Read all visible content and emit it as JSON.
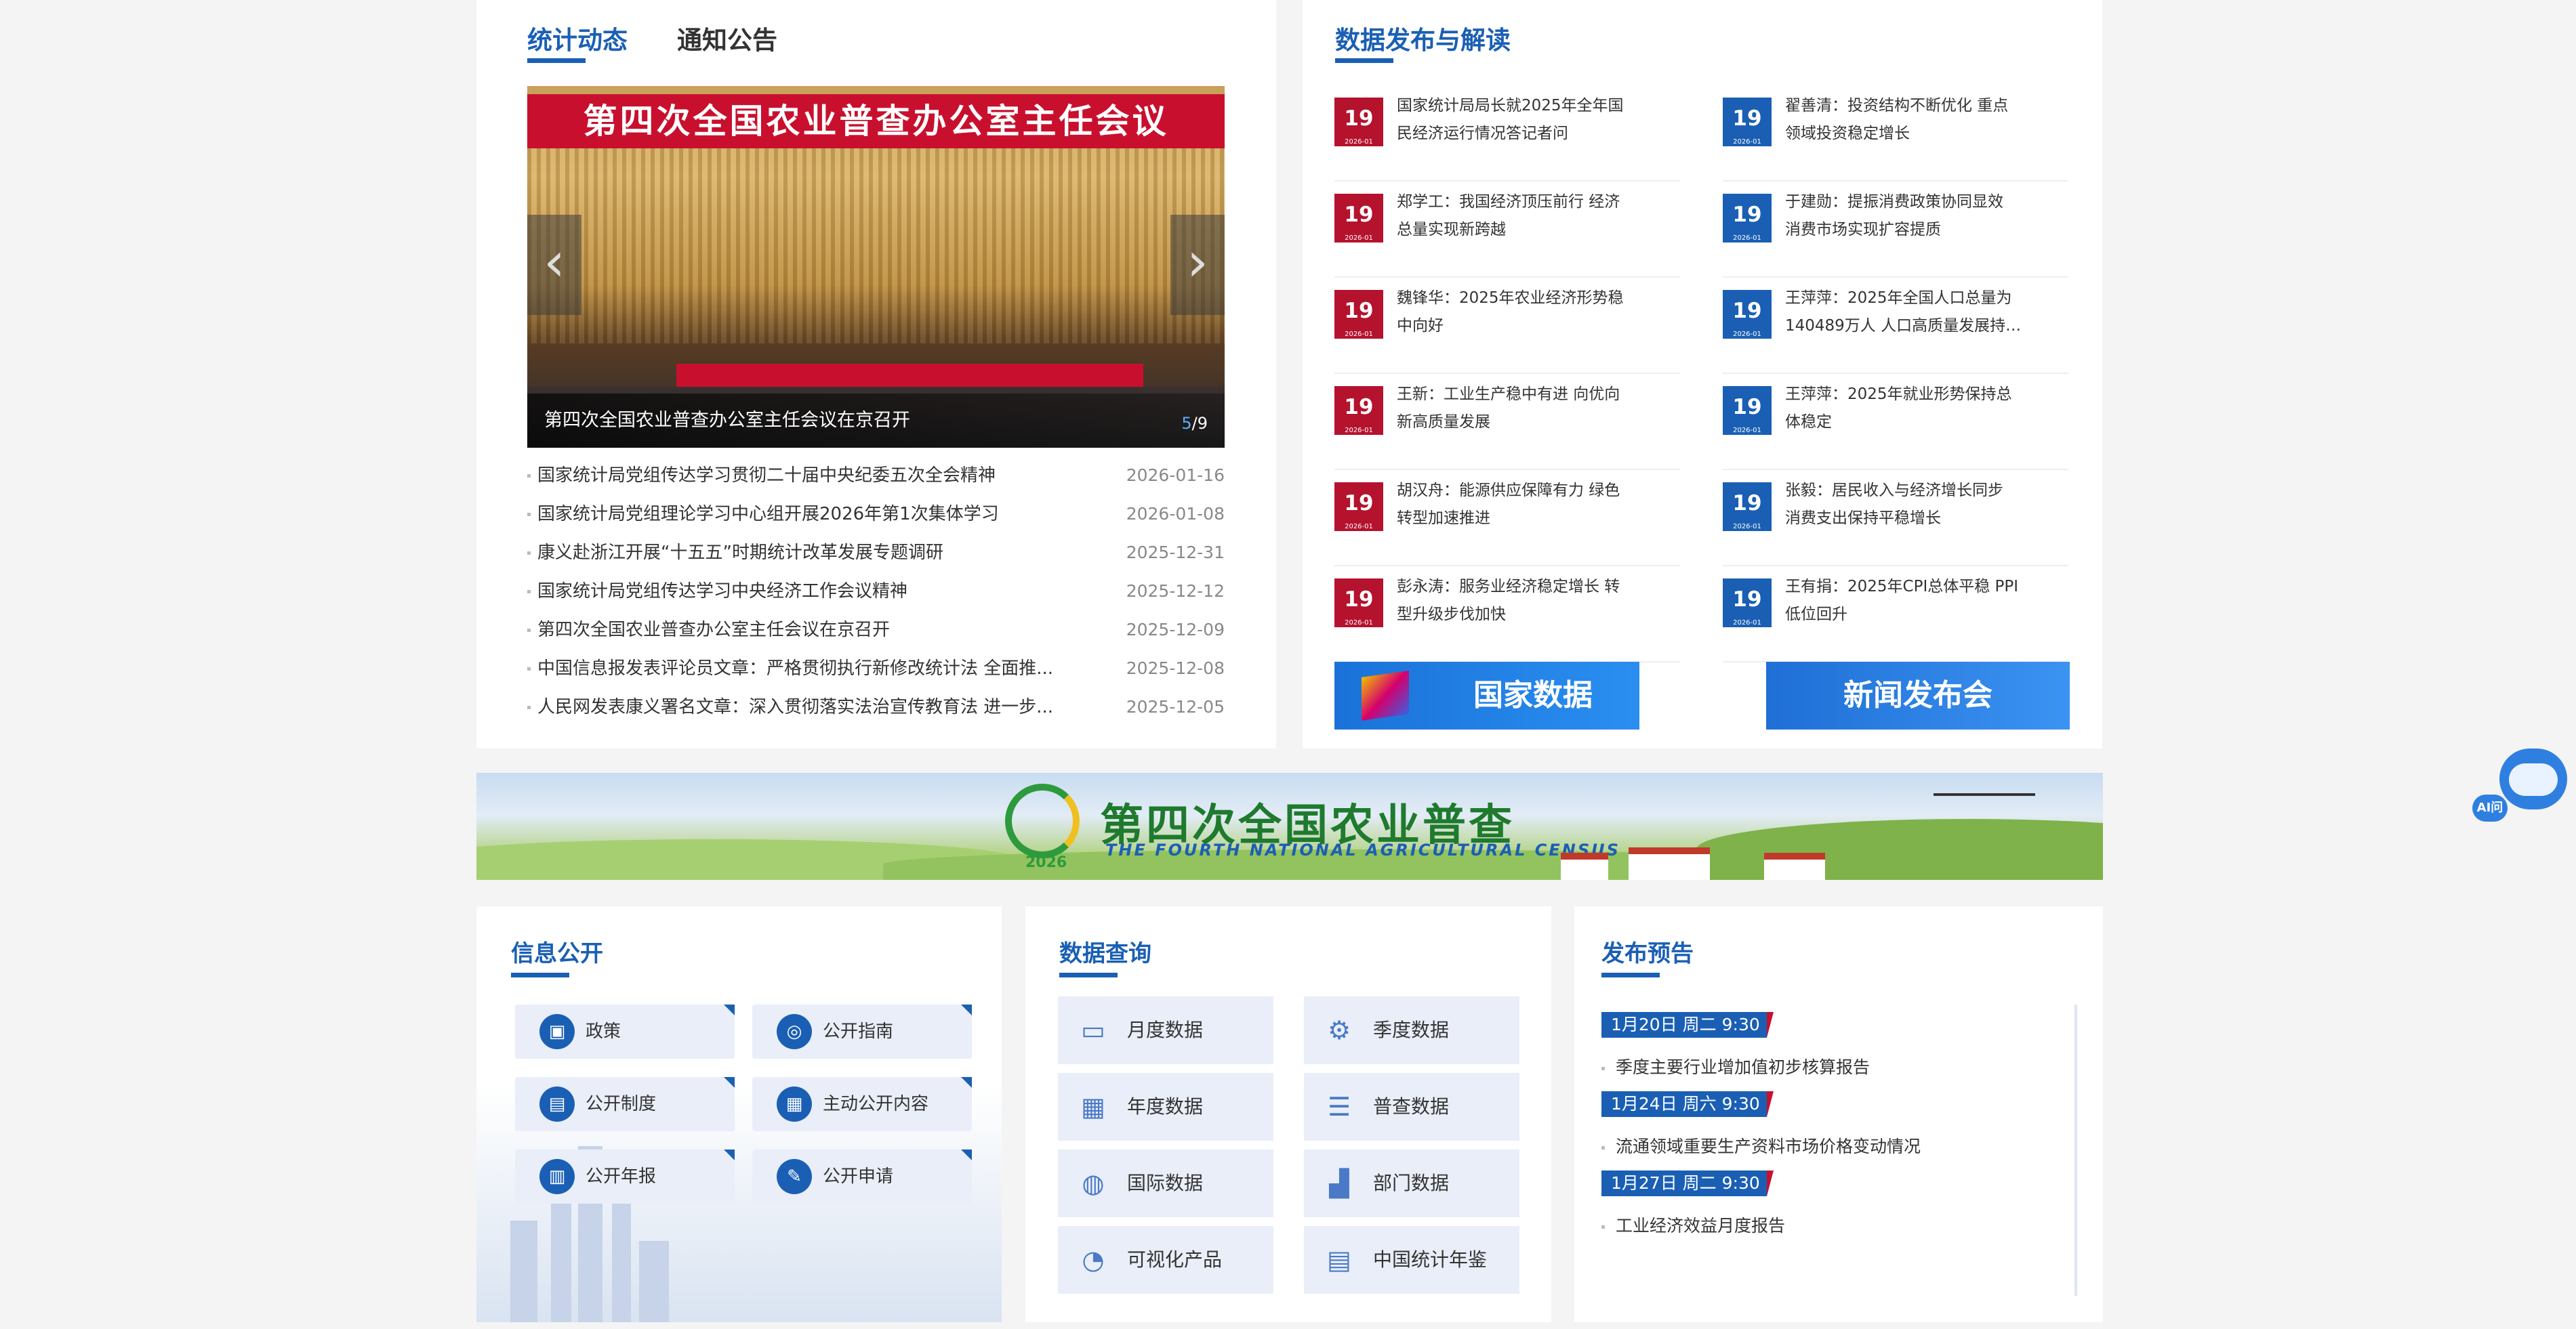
{
  "news_panel": {
    "tabs": [
      "统计动态",
      "通知公告"
    ],
    "slider": {
      "banner_text": "第四次全国农业普查办公室主任会议",
      "caption": "第四次全国农业普查办公室主任会议在京召开",
      "current": "5",
      "total": "/9",
      "prev_icon": "chevron-left-icon",
      "next_icon": "chevron-right-icon"
    },
    "items": [
      {
        "title": "国家统计局党组传达学习贯彻二十届中央纪委五次全会精神",
        "date": "2026-01-16"
      },
      {
        "title": "国家统计局党组理论学习中心组开展2026年第1次集体学习",
        "date": "2026-01-08"
      },
      {
        "title": "康义赴浙江开展“十五五”时期统计改革发展专题调研",
        "date": "2025-12-31"
      },
      {
        "title": "国家统计局党组传达学习中央经济工作会议精神",
        "date": "2025-12-12"
      },
      {
        "title": "第四次全国农业普查办公室主任会议在京召开",
        "date": "2025-12-09"
      },
      {
        "title": "中国信息报发表评论员文章：严格贯彻执行新修改统计法 全面推...",
        "date": "2025-12-08"
      },
      {
        "title": "人民网发表康义署名文章：深入贯彻落实法治宣传教育法 进一步...",
        "date": "2025-12-05"
      }
    ]
  },
  "release_panel": {
    "title": "数据发布与解读",
    "day": "19",
    "ym": "2026-01",
    "left": [
      {
        "l1": "国家统计局局长就2025年全年国",
        "l2": "民经济运行情况答记者问"
      },
      {
        "l1": "郑学工：我国经济顶压前行 经济",
        "l2": "总量实现新跨越"
      },
      {
        "l1": "魏锋华：2025年农业经济形势稳",
        "l2": "中向好"
      },
      {
        "l1": "王新：工业生产稳中有进 向优向",
        "l2": "新高质量发展"
      },
      {
        "l1": "胡汉舟：能源供应保障有力 绿色",
        "l2": "转型加速推进"
      },
      {
        "l1": "彭永涛：服务业经济稳定增长 转",
        "l2": "型升级步伐加快"
      }
    ],
    "right": [
      {
        "l1": "翟善清：投资结构不断优化 重点",
        "l2": "领域投资稳定增长"
      },
      {
        "l1": "于建勋：提振消费政策协同显效",
        "l2": "消费市场实现扩容提质"
      },
      {
        "l1": "王萍萍：2025年全国人口总量为",
        "l2": "140489万人 人口高质量发展持…"
      },
      {
        "l1": "王萍萍：2025年就业形势保持总",
        "l2": "体稳定"
      },
      {
        "l1": "张毅：居民收入与经济增长同步",
        "l2": "消费支出保持平稳增长"
      },
      {
        "l1": "王有捐：2025年CPI总体平稳 PPI",
        "l2": "低位回升"
      }
    ],
    "promo_national": "国家数据",
    "promo_press": "新闻发布会"
  },
  "census_banner": {
    "title": "第四次全国农业普查",
    "subtitle": "THE FOURTH NATIONAL AGRICULTURAL CENSUS",
    "year": "2026"
  },
  "info_panel": {
    "title": "信息公开",
    "buttons": [
      {
        "label": "政策",
        "icon": "policy-icon"
      },
      {
        "label": "公开指南",
        "icon": "compass-icon"
      },
      {
        "label": "公开制度",
        "icon": "book-icon"
      },
      {
        "label": "主动公开内容",
        "icon": "document-icon"
      },
      {
        "label": "公开年报",
        "icon": "report-icon"
      },
      {
        "label": "公开申请",
        "icon": "edit-icon"
      }
    ]
  },
  "query_panel": {
    "title": "数据查询",
    "buttons": [
      {
        "label": "月度数据",
        "icon": "monitor-icon"
      },
      {
        "label": "季度数据",
        "icon": "gear-chart-icon"
      },
      {
        "label": "年度数据",
        "icon": "calendar-icon"
      },
      {
        "label": "普查数据",
        "icon": "list-icon"
      },
      {
        "label": "国际数据",
        "icon": "globe-icon"
      },
      {
        "label": "部门数据",
        "icon": "bar-chart-icon"
      },
      {
        "label": "可视化产品",
        "icon": "visual-icon"
      },
      {
        "label": "中国统计年鉴",
        "icon": "yearbook-icon"
      }
    ]
  },
  "preview_panel": {
    "title": "发布预告",
    "entries": [
      {
        "date": "1月20日 周二 9:30",
        "item": "季度主要行业增加值初步核算报告"
      },
      {
        "date": "1月24日 周六 9:30",
        "item": "流通领域重要生产资料市场价格变动情况"
      },
      {
        "date": "1月27日 周二 9:30",
        "item": "工业经济效益月度报告"
      }
    ]
  },
  "assistant": {
    "label": "AI问"
  }
}
